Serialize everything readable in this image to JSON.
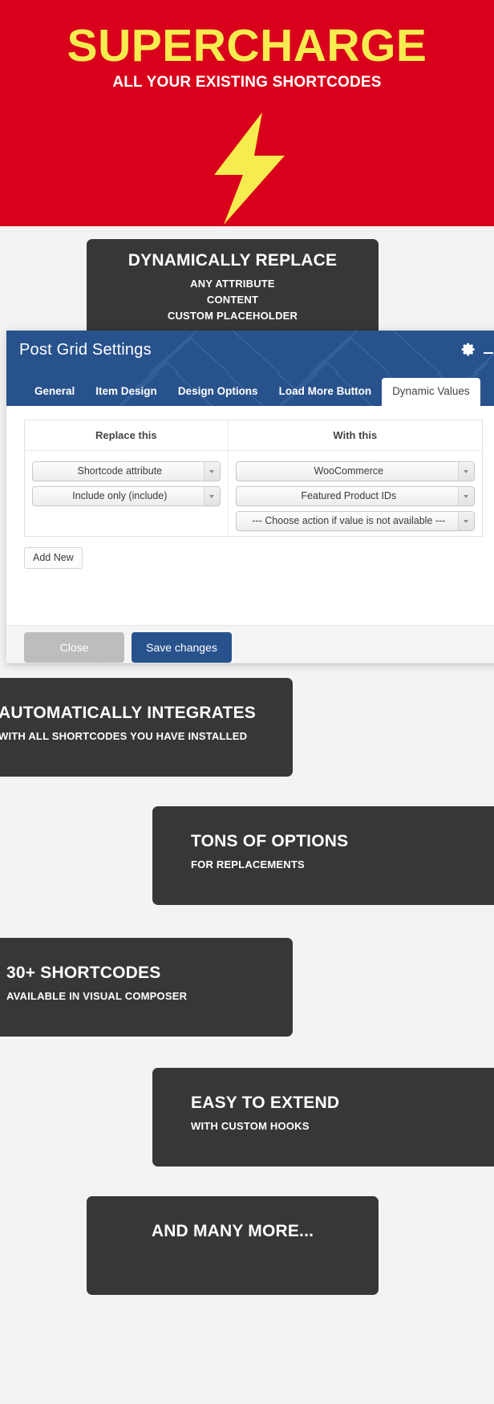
{
  "hero": {
    "title": "SUPERCHARGE",
    "subtitle": "ALL YOUR EXISTING SHORTCODES",
    "bolt_icon": "lightning-bolt-icon",
    "bg_color": "#d9001b",
    "title_color": "#f7ec4f",
    "subtitle_color": "#ffffff"
  },
  "cards": {
    "replace": {
      "heading": "DYNAMICALLY REPLACE",
      "line1": "ANY ATTRIBUTE",
      "line2": "CONTENT",
      "line3": "CUSTOM PLACEHOLDER"
    },
    "integrates": {
      "heading": "AUTOMATICALLY INTEGRATES",
      "sub": "WITH ALL SHORTCODES YOU HAVE INSTALLED"
    },
    "tons": {
      "heading": "TONS OF OPTIONS",
      "sub": "FOR REPLACEMENTS"
    },
    "shortcodes30": {
      "heading": "30+ SHORTCODES",
      "sub": "AVAILABLE IN VISUAL COMPOSER"
    },
    "easy": {
      "heading": "EASY TO EXTEND",
      "sub": "WITH CUSTOM HOOKS"
    },
    "more": {
      "heading": "AND MANY MORE..."
    },
    "bg_color": "#373737"
  },
  "modal": {
    "title": "Post Grid Settings",
    "header_color": "#28528c",
    "gear_icon": "gear-icon",
    "minimize_icon": "minimize-icon",
    "tabs": [
      {
        "label": "General",
        "active": false
      },
      {
        "label": "Item Design",
        "active": false
      },
      {
        "label": "Design Options",
        "active": false
      },
      {
        "label": "Load More Button",
        "active": false
      },
      {
        "label": "Dynamic Values",
        "active": true
      }
    ],
    "table": {
      "headers": {
        "left": "Replace this",
        "right": "With this"
      },
      "left_selects": [
        {
          "value": "Shortcode attribute"
        },
        {
          "value": "Include only (include)"
        }
      ],
      "right_selects": [
        {
          "value": "WooCommerce"
        },
        {
          "value": "Featured Product IDs"
        },
        {
          "value": "--- Choose action if value is not available ---"
        }
      ]
    },
    "add_new_label": "Add New",
    "footer": {
      "close_label": "Close",
      "save_label": "Save changes",
      "close_color": "#bdbdbd",
      "save_color": "#28528c"
    }
  }
}
